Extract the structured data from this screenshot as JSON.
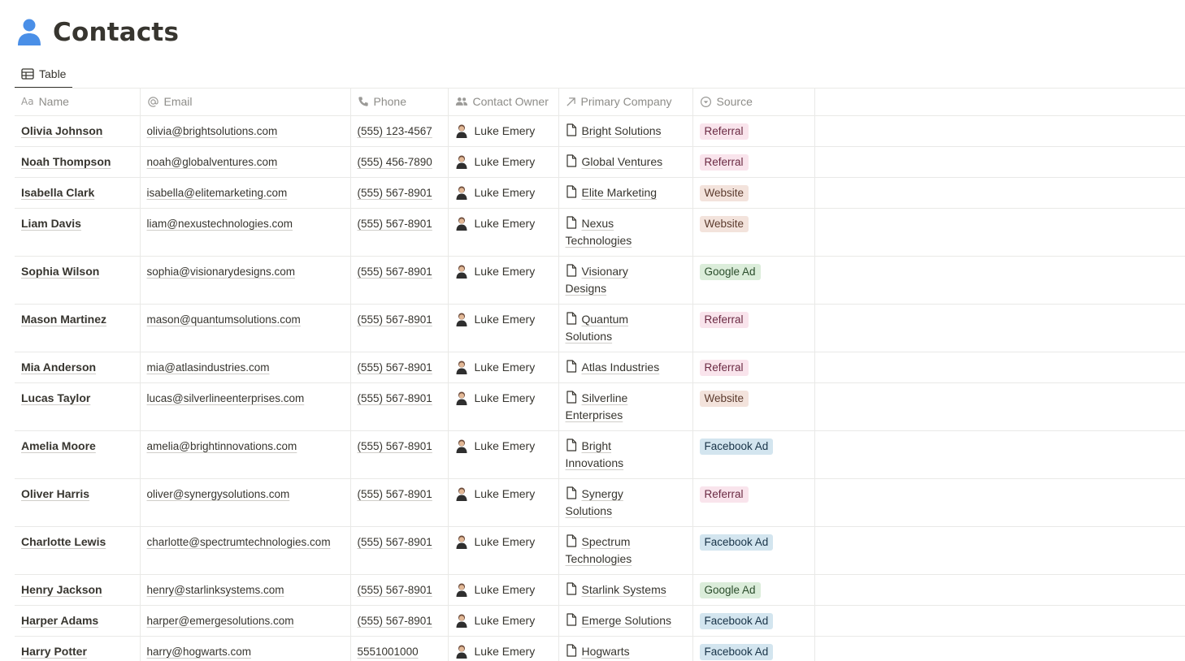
{
  "page": {
    "title": "Contacts",
    "icon": "person-icon"
  },
  "view": {
    "tab_label": "Table",
    "tab_icon": "table-icon"
  },
  "columns": [
    {
      "key": "name",
      "label": "Name",
      "icon": "text-aa-icon"
    },
    {
      "key": "email",
      "label": "Email",
      "icon": "at-icon"
    },
    {
      "key": "phone",
      "label": "Phone",
      "icon": "phone-icon"
    },
    {
      "key": "owner",
      "label": "Contact Owner",
      "icon": "people-icon"
    },
    {
      "key": "company",
      "label": "Primary Company",
      "icon": "relation-arrow-icon"
    },
    {
      "key": "source",
      "label": "Source",
      "icon": "select-icon"
    }
  ],
  "source_colors": {
    "Referral": {
      "bg": "#f9e4ec",
      "fg": "#6b2a43"
    },
    "Website": {
      "bg": "#f3e3dc",
      "fg": "#5c3b2e"
    },
    "Google Ad": {
      "bg": "#dbedda",
      "fg": "#2b4d2c"
    },
    "Facebook Ad": {
      "bg": "#d3e5ef",
      "fg": "#183347"
    }
  },
  "rows": [
    {
      "name": "Olivia Johnson",
      "email": "olivia@brightsolutions.com",
      "phone": "(555) 123-4567",
      "owner": "Luke Emery",
      "company": [
        "Bright Solutions"
      ],
      "source": "Referral"
    },
    {
      "name": "Noah Thompson",
      "email": "noah@globalventures.com",
      "phone": "(555) 456-7890",
      "owner": "Luke Emery",
      "company": [
        "Global Ventures"
      ],
      "source": "Referral"
    },
    {
      "name": "Isabella Clark",
      "email": "isabella@elitemarketing.com",
      "phone": "(555) 567-8901",
      "owner": "Luke Emery",
      "company": [
        "Elite Marketing"
      ],
      "source": "Website"
    },
    {
      "name": "Liam Davis",
      "email": "liam@nexustechnologies.com",
      "phone": "(555) 567-8901",
      "owner": "Luke Emery",
      "company": [
        "Nexus",
        "Technologies"
      ],
      "source": "Website"
    },
    {
      "name": "Sophia Wilson",
      "email": "sophia@visionarydesigns.com",
      "phone": "(555) 567-8901",
      "owner": "Luke Emery",
      "company": [
        "Visionary",
        "Designs"
      ],
      "source": "Google Ad"
    },
    {
      "name": "Mason Martinez",
      "email": "mason@quantumsolutions.com",
      "phone": "(555) 567-8901",
      "owner": "Luke Emery",
      "company": [
        "Quantum",
        "Solutions"
      ],
      "source": "Referral"
    },
    {
      "name": "Mia Anderson",
      "email": "mia@atlasindustries.com",
      "phone": "(555) 567-8901",
      "owner": "Luke Emery",
      "company": [
        "Atlas Industries"
      ],
      "source": "Referral"
    },
    {
      "name": "Lucas Taylor",
      "email": "lucas@silverlineenterprises.com",
      "phone": "(555) 567-8901",
      "owner": "Luke Emery",
      "company": [
        "Silverline",
        "Enterprises"
      ],
      "source": "Website"
    },
    {
      "name": "Amelia Moore",
      "email": "amelia@brightinnovations.com",
      "phone": "(555) 567-8901",
      "owner": "Luke Emery",
      "company": [
        "Bright",
        "Innovations"
      ],
      "source": "Facebook Ad"
    },
    {
      "name": "Oliver Harris",
      "email": "oliver@synergysolutions.com",
      "phone": "(555) 567-8901",
      "owner": "Luke Emery",
      "company": [
        "Synergy",
        "Solutions"
      ],
      "source": "Referral"
    },
    {
      "name": "Charlotte Lewis",
      "email": "charlotte@spectrumtechnologies.com",
      "phone": "(555) 567-8901",
      "owner": "Luke Emery",
      "company": [
        "Spectrum",
        "Technologies"
      ],
      "source": "Facebook Ad"
    },
    {
      "name": "Henry Jackson",
      "email": "henry@starlinksystems.com",
      "phone": "(555) 567-8901",
      "owner": "Luke Emery",
      "company": [
        "Starlink Systems"
      ],
      "source": "Google Ad"
    },
    {
      "name": "Harper Adams",
      "email": "harper@emergesolutions.com",
      "phone": "(555) 567-8901",
      "owner": "Luke Emery",
      "company": [
        "Emerge Solutions"
      ],
      "source": "Facebook Ad"
    },
    {
      "name": "Harry Potter",
      "email": "harry@hogwarts.com",
      "phone": "5551001000",
      "owner": "Luke Emery",
      "company": [
        "Hogwarts"
      ],
      "source": "Facebook Ad"
    }
  ]
}
